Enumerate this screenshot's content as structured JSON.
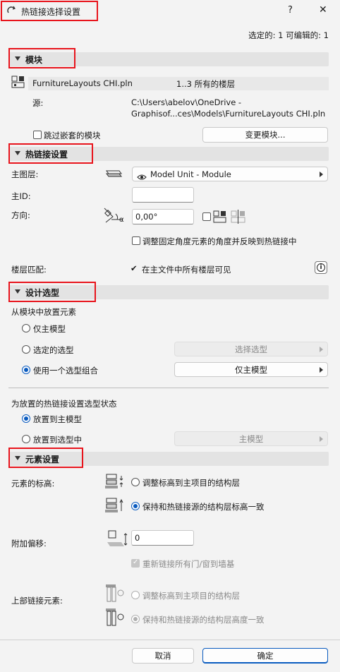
{
  "window": {
    "title": "热链接选择设置",
    "help": "?",
    "close": "✕"
  },
  "summary": "选定的: 1 可编辑的: 1",
  "sections": {
    "module": "模块",
    "hotlink": "热链接设置",
    "design_option": "设计选型",
    "element": "元素设置"
  },
  "module": {
    "file_name": "FurnitureLayouts CHI.pln",
    "stories": "1..3 所有的楼层",
    "source_label": "源:",
    "source_line1": "C:\\Users\\abelov\\OneDrive -",
    "source_line2": "Graphisof...ces\\Models\\FurnitureLayouts CHI.pln",
    "skip_nested_label": "跳过嵌套的模块",
    "change_module_button": "变更模块..."
  },
  "hotlink": {
    "master_layer_label": "主图层:",
    "master_layer_value": "Model Unit - Module",
    "master_id_label": "主ID:",
    "master_id_value": "",
    "orientation_label": "方向:",
    "orientation_value": "0,00°",
    "alpha": "α",
    "adjust_angle_label": "调整固定角度元素的角度并反映到热链接中",
    "story_match_label": "楼层匹配:",
    "story_match_value": "在主文件中所有楼层可见",
    "check_mark": "✔",
    "info": "i"
  },
  "design_option": {
    "place_from_label": "从模块中放置元素",
    "option_main_model": "仅主模型",
    "option_selected": "选定的选型",
    "select_option_button": "选择选型",
    "option_combination": "使用一个选型组合",
    "combination_value": "仅主模型",
    "status_label": "为放置的热链接设置选型状态",
    "place_to_main": "放置到主模型",
    "place_to_option": "放置到选型中",
    "option_target_value": "主模型"
  },
  "element": {
    "elevation_label": "元素的标高:",
    "elev_adjust_label": "调整标高到主项目的结构层",
    "elev_keep_label": "保持和热链接源的结构层标高一致",
    "offset_label": "附加偏移:",
    "offset_value": "0",
    "relink_label": "重新链接所有门/窗到墙基",
    "top_link_label": "上部链接元素:",
    "top_adjust_label": "调整标高到主项目的结构层",
    "top_keep_label": "保持和热链接源的结构层高度一致"
  },
  "footer": {
    "cancel": "取消",
    "ok": "确定"
  },
  "colors": {
    "highlight_box": "#e8141c",
    "accent": "#0a5bbf",
    "section_bar": "#e3e3e3"
  }
}
